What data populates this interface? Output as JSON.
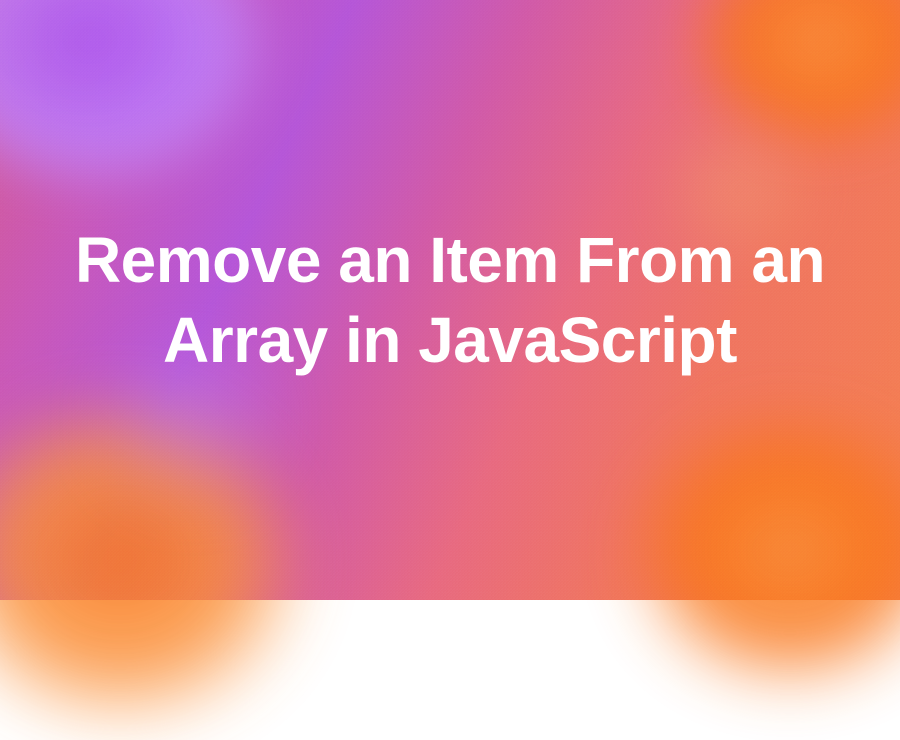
{
  "title": "Remove an Item From an Array in JavaScript"
}
